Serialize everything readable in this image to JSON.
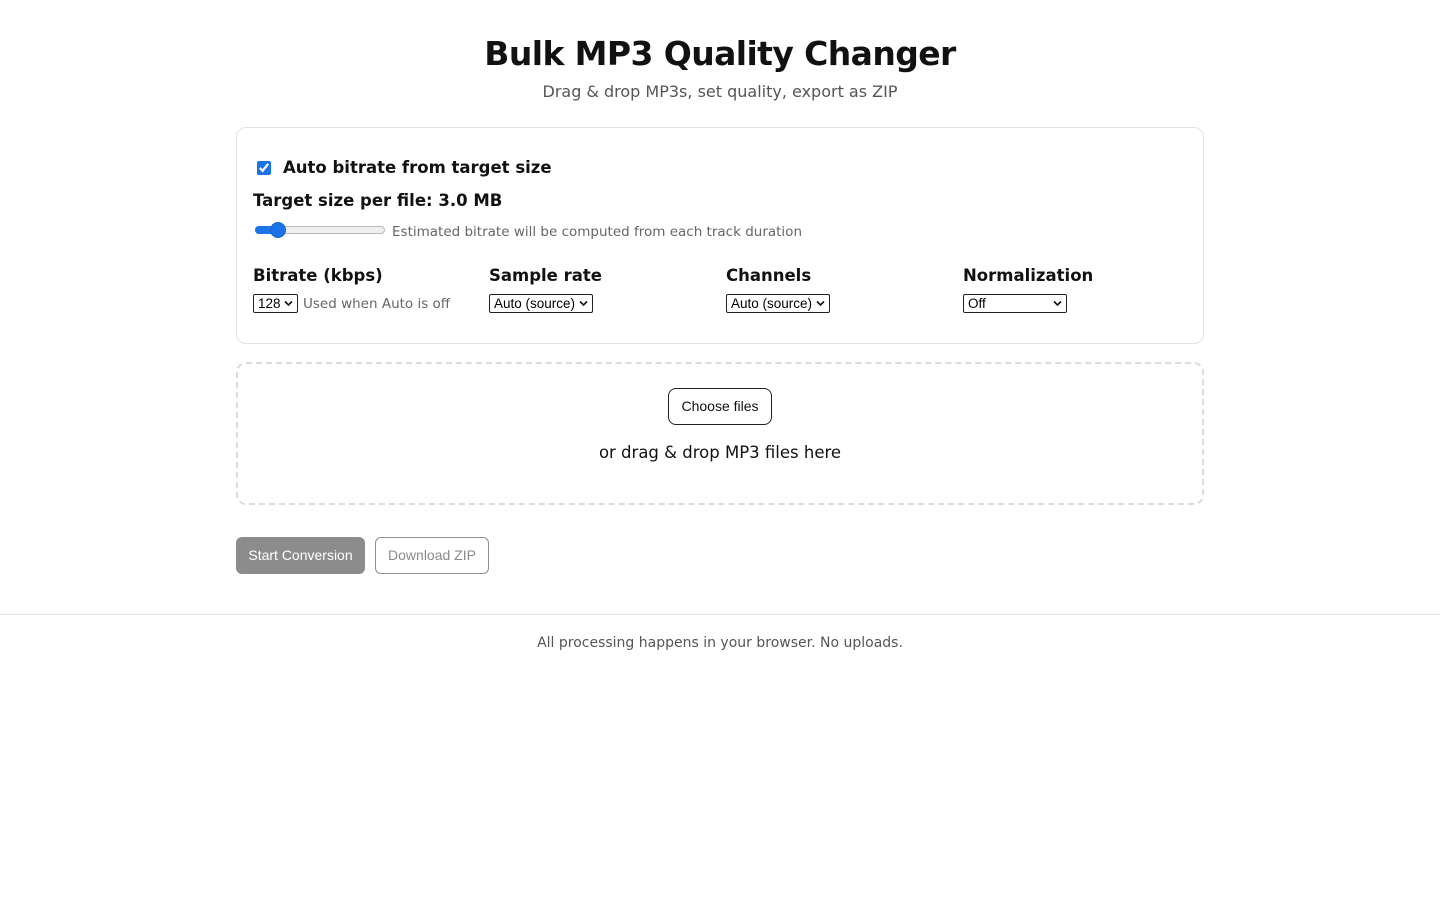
{
  "header": {
    "title": "Bulk MP3 Quality Changer",
    "subtitle": "Drag & drop MP3s, set quality, export as ZIP"
  },
  "settings": {
    "auto_bitrate": {
      "label": "Auto bitrate from target size",
      "checked": true
    },
    "target_size": {
      "label": "Target size per file: 3.0 MB",
      "slider_fraction": 0.17,
      "hint": "Estimated bitrate will be computed from each track duration"
    },
    "bitrate": {
      "label": "Bitrate (kbps)",
      "value": "128",
      "hint": "Used when Auto is off"
    },
    "sample_rate": {
      "label": "Sample rate",
      "value": "Auto (source)"
    },
    "channels": {
      "label": "Channels",
      "value": "Auto (source)"
    },
    "normalization": {
      "label": "Normalization",
      "value": "Off"
    }
  },
  "dropzone": {
    "choose_label": "Choose files",
    "text": "or drag & drop MP3 files here"
  },
  "actions": {
    "start_label": "Start Conversion",
    "start_disabled": true,
    "download_label": "Download ZIP",
    "download_disabled": true
  },
  "footer": {
    "text": "All processing happens in your browser. No uploads."
  },
  "colors": {
    "accent": "#1a73e8",
    "muted_text": "#555555",
    "disabled_button": "#8c8c8c"
  }
}
